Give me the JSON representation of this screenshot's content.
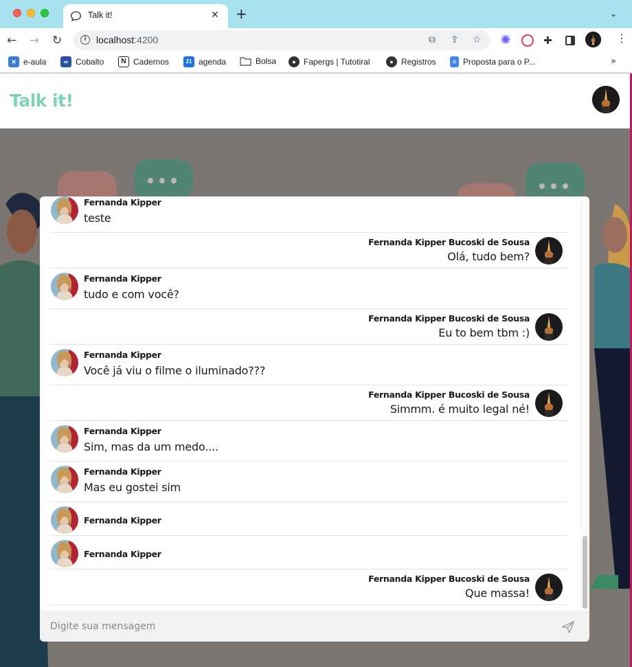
{
  "browser": {
    "tab_title": "Talk it!",
    "tab_close": "✕",
    "new_tab": "+",
    "url_host": "localhost",
    "url_port": ":4200",
    "bookmarks": [
      {
        "label": "e-aula",
        "icon": "e-aula-icon",
        "color": "#3b7bd4"
      },
      {
        "label": "Cobalto",
        "icon": "cobalto-icon",
        "color": "#2c4f9e"
      },
      {
        "label": "Cadernos",
        "icon": "notion-icon",
        "color": "#222222"
      },
      {
        "label": "agenda",
        "icon": "calendar-icon",
        "color": "#1a73e8"
      },
      {
        "label": "Bolsa",
        "icon": "folder-icon",
        "color": "#5f6368"
      },
      {
        "label": "Fapergs | Tutotiral",
        "icon": "globe-icon",
        "color": "#333333"
      },
      {
        "label": "Registros",
        "icon": "globe-icon",
        "color": "#333333"
      },
      {
        "label": "Proposta para o P...",
        "icon": "docs-icon",
        "color": "#4285f4"
      }
    ],
    "bookmarks_more": "»"
  },
  "app": {
    "logo": "Talk it!",
    "brand_color": "#7ed3b7"
  },
  "messages": [
    {
      "side": "in",
      "name": "Fernanda Kipper",
      "text": "teste"
    },
    {
      "side": "out",
      "name": "Fernanda Kipper Bucoski de Sousa",
      "text": "Olá, tudo bem?"
    },
    {
      "side": "in",
      "name": "Fernanda Kipper",
      "text": "tudo e com você?"
    },
    {
      "side": "out",
      "name": "Fernanda Kipper Bucoski de Sousa",
      "text": "Eu to bem tbm :)"
    },
    {
      "side": "in",
      "name": "Fernanda Kipper",
      "text": "Você já viu o filme o iluminado???"
    },
    {
      "side": "out",
      "name": "Fernanda Kipper Bucoski de Sousa",
      "text": "Simmm. é muito legal né!"
    },
    {
      "side": "in",
      "name": "Fernanda Kipper",
      "text": "Sim, mas da um medo...."
    },
    {
      "side": "in",
      "name": "Fernanda Kipper",
      "text": "Mas eu gostei sim"
    },
    {
      "side": "in",
      "name": "Fernanda Kipper",
      "text": ""
    },
    {
      "side": "in",
      "name": "Fernanda Kipper",
      "text": ""
    },
    {
      "side": "out",
      "name": "Fernanda Kipper Bucoski de Sousa",
      "text": "Que massa!"
    }
  ],
  "composer": {
    "placeholder": "Digite sua mensagem",
    "value": ""
  }
}
